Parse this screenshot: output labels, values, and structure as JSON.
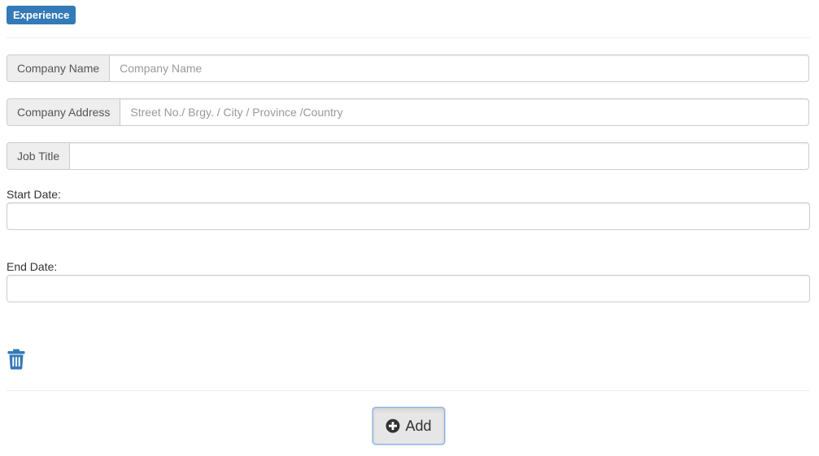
{
  "section": {
    "badge": "Experience"
  },
  "fields": {
    "company_name": {
      "label": "Company Name",
      "value": "",
      "placeholder": "Company Name"
    },
    "company_address": {
      "label": "Company Address",
      "value": "",
      "placeholder": "Street No./ Brgy. / City / Province /Country"
    },
    "job_title": {
      "label": "Job Title",
      "value": "",
      "placeholder": ""
    },
    "start_date": {
      "label": "Start Date:",
      "value": ""
    },
    "end_date": {
      "label": "End Date:",
      "value": ""
    }
  },
  "actions": {
    "delete_icon": "trash-icon",
    "add_label": "Add",
    "add_icon": "plus-circle-icon"
  },
  "colors": {
    "accent": "#337ab7",
    "addon_bg": "#eeeeee",
    "border": "#cccccc"
  }
}
